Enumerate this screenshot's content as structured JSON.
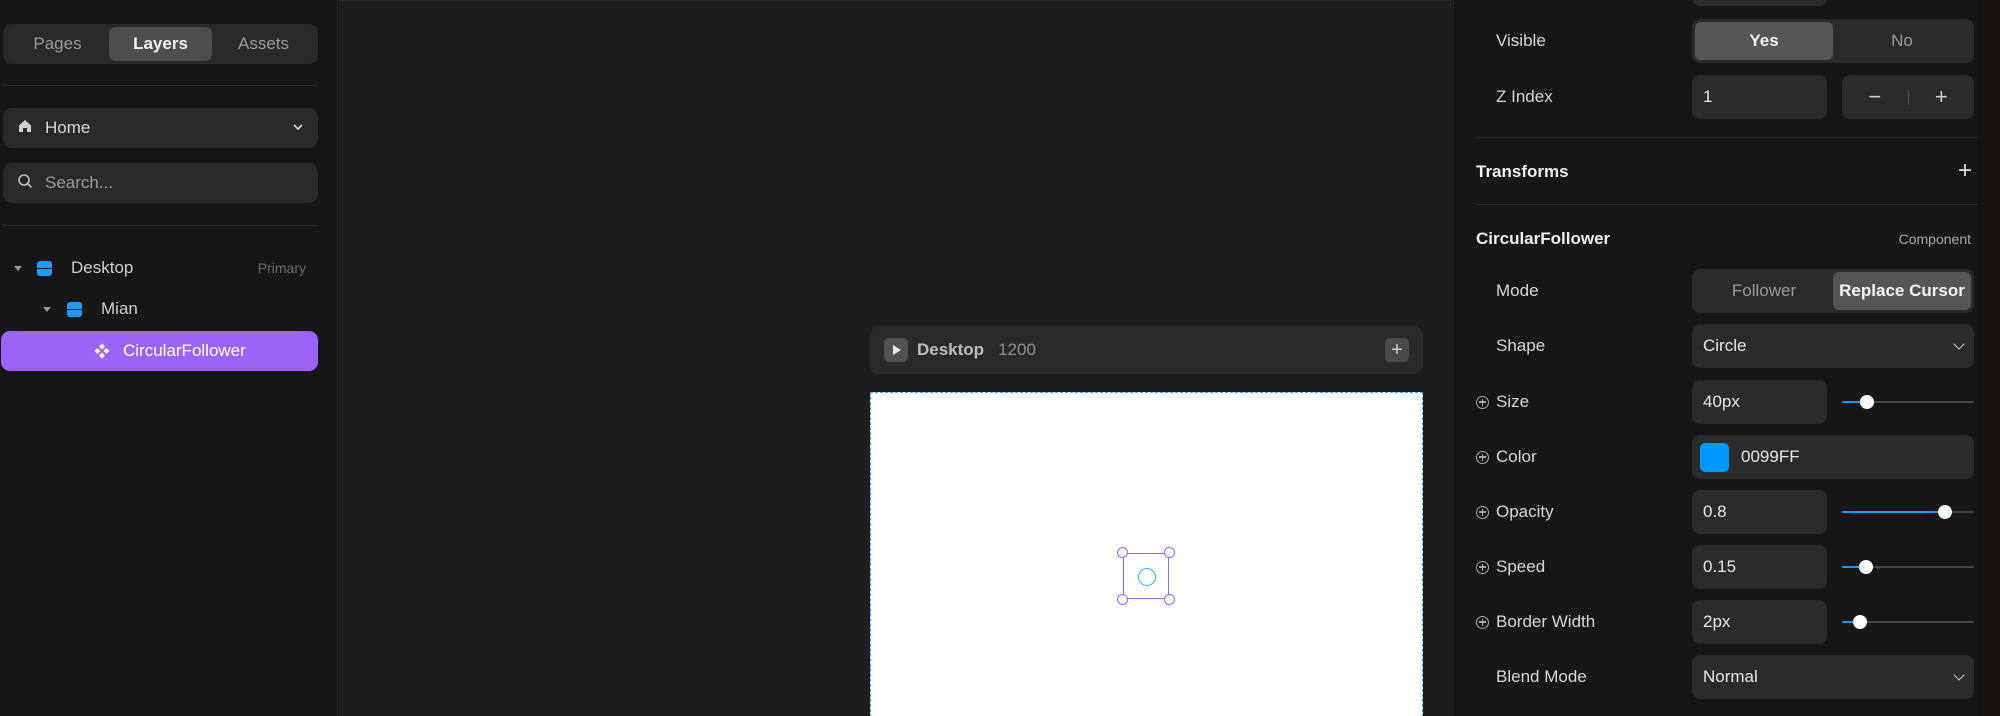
{
  "left_panel": {
    "tabs": [
      "Pages",
      "Layers",
      "Assets"
    ],
    "active_tab": "Layers",
    "page_dropdown": "Home",
    "search_placeholder": "Search...",
    "layers": [
      {
        "label": "Desktop",
        "tag": "Primary"
      },
      {
        "label": "Mian"
      },
      {
        "label": "CircularFollower",
        "selected": true
      }
    ]
  },
  "canvas": {
    "frame_name": "Desktop",
    "frame_width": "1200",
    "artboard_bg": "#ffffff",
    "selection_color": "#9b63f8"
  },
  "right_panel": {
    "visible": {
      "label": "Visible",
      "options": [
        "Yes",
        "No"
      ],
      "active": "Yes"
    },
    "z_index": {
      "label": "Z Index",
      "value": "1",
      "minus": "−",
      "plus": "+"
    },
    "transforms": {
      "title": "Transforms",
      "add": "+"
    },
    "component": {
      "title": "CircularFollower",
      "subtitle": "Component"
    },
    "mode": {
      "label": "Mode",
      "options": [
        "Follower",
        "Replace Cursor"
      ],
      "active": "Replace Cursor"
    },
    "shape": {
      "label": "Shape",
      "value": "Circle"
    },
    "size": {
      "label": "Size",
      "value": "40px",
      "slider_fraction": 0.19
    },
    "color": {
      "label": "Color",
      "value": "0099FF",
      "swatch": "#0099FF"
    },
    "opacity": {
      "label": "Opacity",
      "value": "0.8",
      "slider_fraction": 0.78
    },
    "speed": {
      "label": "Speed",
      "value": "0.15",
      "slider_fraction": 0.18
    },
    "border_width": {
      "label": "Border Width",
      "value": "2px",
      "slider_fraction": 0.14
    },
    "blend_mode": {
      "label": "Blend Mode",
      "value": "Normal"
    }
  },
  "colors": {
    "accent_purple": "#9b63f8",
    "accent_blue": "#0a9bff"
  }
}
